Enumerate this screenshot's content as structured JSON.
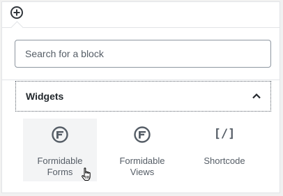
{
  "toolbar": {
    "add_block_icon": "plus-circle-icon"
  },
  "search": {
    "placeholder": "Search for a block",
    "value": ""
  },
  "section": {
    "title": "Widgets",
    "expanded": true,
    "toggle_icon": "chevron-up-icon"
  },
  "blocks": [
    {
      "label_line1": "Formidable",
      "label_line2": "Forms",
      "icon": "formidable-icon",
      "hovered": true
    },
    {
      "label_line1": "Formidable",
      "label_line2": "Views",
      "icon": "formidable-icon",
      "hovered": false
    },
    {
      "label_line1": "Shortcode",
      "label_line2": "",
      "icon": "shortcode-icon",
      "icon_text": "[/]",
      "hovered": false
    }
  ],
  "colors": {
    "text": "#555d66",
    "border": "#8d96a0",
    "hover_bg": "#f3f4f5",
    "heading": "#23282d"
  }
}
